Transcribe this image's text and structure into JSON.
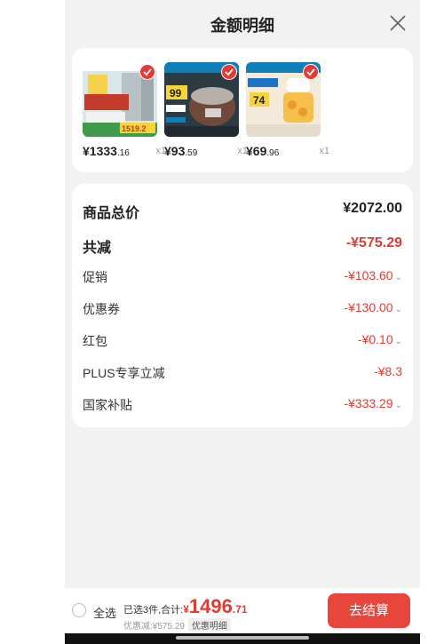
{
  "header": {
    "title": "金额明细"
  },
  "products": [
    {
      "name": "fridge",
      "price_int": "¥1333",
      "price_dec": ".16",
      "qty": "x1",
      "banner": "1519.2"
    },
    {
      "name": "rice-cooker",
      "price_int": "¥93",
      "price_dec": ".59",
      "qty": "x1",
      "banner": "99"
    },
    {
      "name": "blender",
      "price_int": "¥69",
      "price_dec": ".96",
      "qty": "x1",
      "banner": "74"
    }
  ],
  "details": [
    {
      "label": "商品总价",
      "value": "¥2072.00",
      "emphasis": "total"
    },
    {
      "label": "共减",
      "value": "-¥575.29",
      "emphasis": "reduction"
    },
    {
      "label": "促销",
      "value": "-¥103.60",
      "expandable": true
    },
    {
      "label": "优惠券",
      "value": "-¥130.00",
      "expandable": true
    },
    {
      "label": "红包",
      "value": "-¥0.10",
      "expandable": true
    },
    {
      "label": "PLUS专享立减",
      "value": "-¥8.3",
      "expandable": false
    },
    {
      "label": "国家补贴",
      "value": "-¥333.29",
      "expandable": true
    }
  ],
  "bottom": {
    "select_all": "全选",
    "selected_summary": "已选3件,合计:",
    "amount_symbol": "¥",
    "amount_int": "1496",
    "amount_dec": ".71",
    "discount_text": "优惠减:¥575.29",
    "discount_detail": "优惠明细",
    "checkout": "去结算"
  },
  "colors": {
    "accent": "#e23b32",
    "button": "#e8453c",
    "background": "#f2f2f2"
  },
  "icons": {
    "close": "close-icon",
    "check": "check-icon",
    "chevron": "chevron-down-icon"
  }
}
